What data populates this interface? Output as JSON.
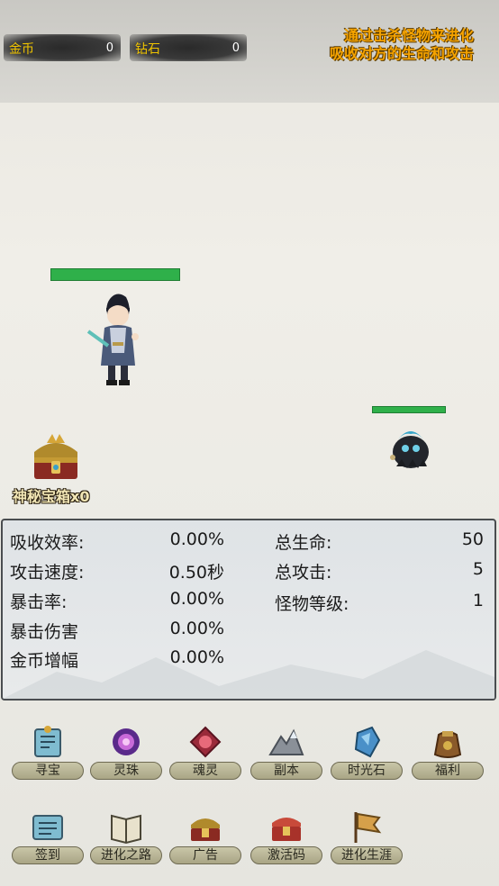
{
  "resources": {
    "gold": {
      "label": "金币",
      "value": "0"
    },
    "diamond": {
      "label": "钻石",
      "value": "0"
    }
  },
  "hint": {
    "line1": "通过击杀怪物来进化",
    "line2": "吸收对方的生命和攻击"
  },
  "chest": {
    "label": "神秘宝箱x0"
  },
  "hero_hp": 1.0,
  "monster_hp": 1.0,
  "stats": {
    "left": [
      {
        "label": "吸收效率:",
        "value": "0.00%"
      },
      {
        "label": "攻击速度:",
        "value": "0.50秒"
      },
      {
        "label": "暴击率:",
        "value": "0.00%"
      },
      {
        "label": "暴击伤害",
        "value": "0.00%"
      },
      {
        "label": "金币增幅",
        "value": "0.00%"
      }
    ],
    "right": [
      {
        "label": "总生命:",
        "value": "50"
      },
      {
        "label": "总攻击:",
        "value": "5"
      },
      {
        "label": "怪物等级:",
        "value": "1"
      }
    ]
  },
  "menu": {
    "row1": [
      {
        "label": "寻宝",
        "icon": "map-scroll-icon"
      },
      {
        "label": "灵珠",
        "icon": "spirit-orb-icon"
      },
      {
        "label": "魂灵",
        "icon": "soul-gem-icon"
      },
      {
        "label": "副本",
        "icon": "mountain-icon"
      },
      {
        "label": "时光石",
        "icon": "crystal-icon"
      },
      {
        "label": "福利",
        "icon": "gift-bag-icon"
      }
    ],
    "row2": [
      {
        "label": "签到",
        "icon": "checkin-scroll-icon"
      },
      {
        "label": "进化之路",
        "icon": "book-icon"
      },
      {
        "label": "广告",
        "icon": "ad-chest-icon"
      },
      {
        "label": "激活码",
        "icon": "code-chest-icon"
      },
      {
        "label": "进化生涯",
        "icon": "banner-flag-icon"
      }
    ]
  }
}
